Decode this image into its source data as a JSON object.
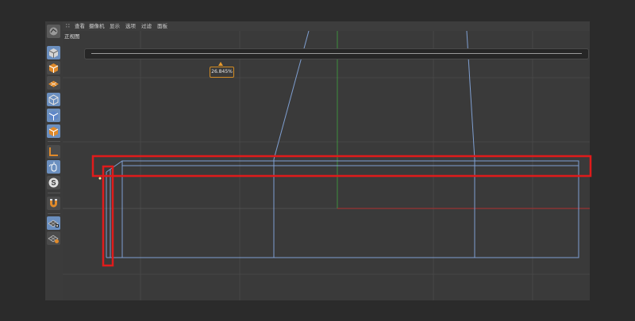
{
  "menu": {
    "items": [
      {
        "label": "查看"
      },
      {
        "label": "摄像机"
      },
      {
        "label": "显示"
      },
      {
        "label": "选项"
      },
      {
        "label": "过滤"
      },
      {
        "label": "面板"
      }
    ]
  },
  "viewport": {
    "title": "正视图"
  },
  "slider": {
    "value_label": "26.845%",
    "value_percent": 26.845
  },
  "toolbar_icons": [
    {
      "name": "camera-icon"
    },
    {
      "name": "cube-icon"
    },
    {
      "name": "checker-cube-icon"
    },
    {
      "name": "plane-icon"
    },
    {
      "name": "wire-cube-icon"
    },
    {
      "name": "polygon-icon"
    },
    {
      "name": "orange-cube-icon"
    },
    {
      "name": "axis-icon"
    },
    {
      "name": "mouse-icon"
    },
    {
      "name": "snap-icon"
    },
    {
      "name": "magnet-icon"
    },
    {
      "name": "lock-grid-icon"
    },
    {
      "name": "grid-icon"
    }
  ],
  "colors": {
    "app_bg": "#3a3a3a",
    "grid": "#4a4a4a",
    "axis_green": "#3f8f3f",
    "axis_red": "#b03030",
    "edges": "#7f9fd1",
    "highlight": "#e01b1b",
    "active_tool": "#6b8fbf",
    "accent": "#e79a2c"
  }
}
